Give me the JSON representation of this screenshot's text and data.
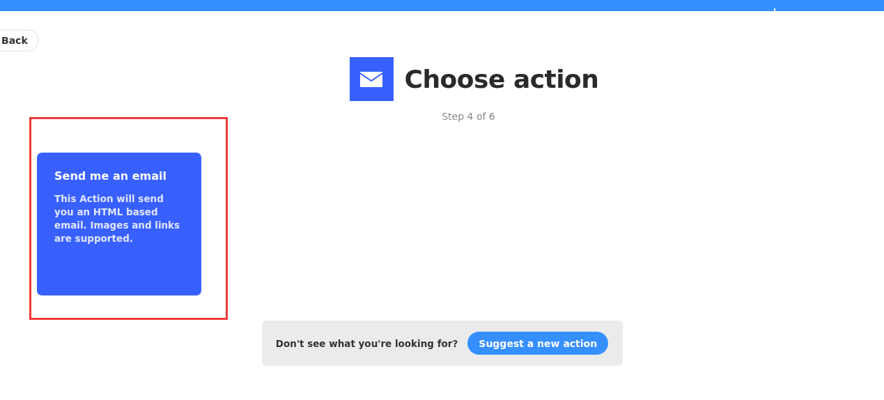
{
  "back_button": {
    "label": "Back"
  },
  "header": {
    "title": "Choose action",
    "step": "Step 4 of 6"
  },
  "actions": [
    {
      "title": "Send me an email",
      "description": "This Action will send you an HTML based email. Images and links are supported.",
      "highlighted": true
    }
  ],
  "footer": {
    "prompt": "Don't see what you're looking for?",
    "button": "Suggest a new action"
  }
}
